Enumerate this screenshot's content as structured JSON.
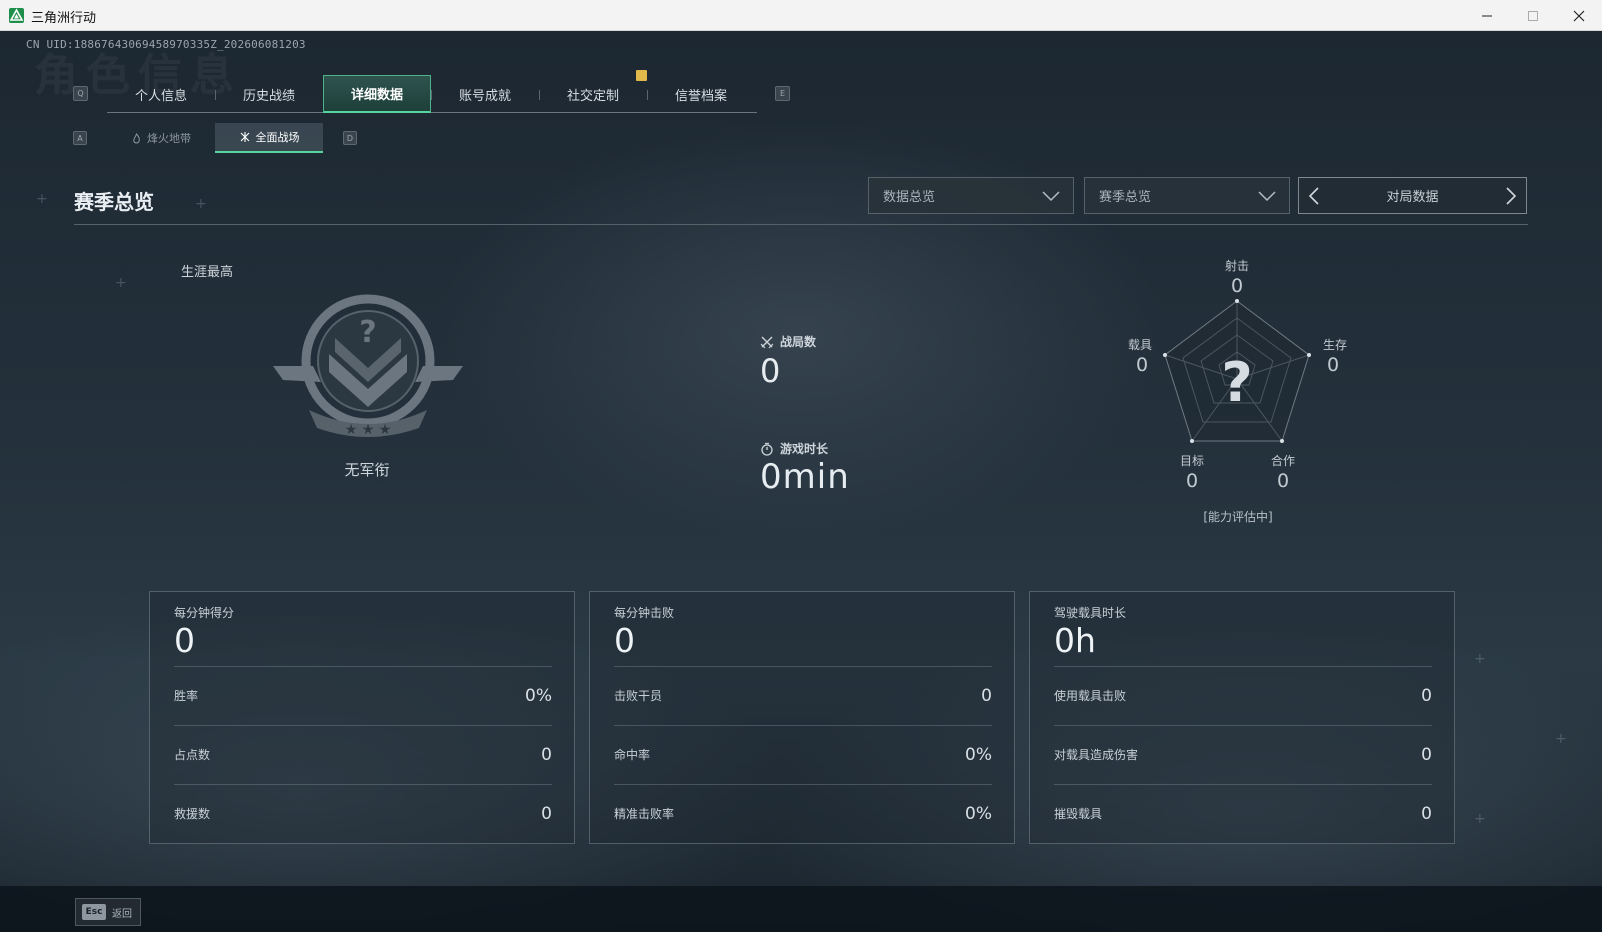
{
  "window": {
    "title": "三角洲行动"
  },
  "uid": "CN UID:18867643069458970335Z_202606081203",
  "background_title": "角色信息",
  "tabs": {
    "key_prev": "Q",
    "key_next": "E",
    "items": [
      {
        "label": "个人信息",
        "active": false
      },
      {
        "label": "历史战绩",
        "active": false
      },
      {
        "label": "详细数据",
        "active": true
      },
      {
        "label": "账号成就",
        "active": false
      },
      {
        "label": "社交定制",
        "active": false
      },
      {
        "label": "信誉档案",
        "active": false
      }
    ]
  },
  "subtabs": {
    "key_prev": "A",
    "key_next": "D",
    "items": [
      {
        "label": "烽火地带",
        "active": false
      },
      {
        "label": "全面战场",
        "active": true
      }
    ]
  },
  "section": {
    "title": "赛季总览",
    "dropdown1": "数据总览",
    "dropdown2": "赛季总览",
    "pager_label": "对局数据"
  },
  "rank": {
    "label": "生涯最高",
    "name": "无军衔"
  },
  "center_stats": {
    "matches_label": "战局数",
    "matches_value": "0",
    "playtime_label": "游戏时长",
    "playtime_value": "0min"
  },
  "radar": {
    "shooting_label": "射击",
    "shooting_value": "0",
    "survival_label": "生存",
    "survival_value": "0",
    "teamwork_label": "合作",
    "teamwork_value": "0",
    "objective_label": "目标",
    "objective_value": "0",
    "vehicle_label": "载具",
    "vehicle_value": "0",
    "status": "[能力评估中]"
  },
  "cards": [
    {
      "title": "每分钟得分",
      "value": "0",
      "rows": [
        {
          "label": "胜率",
          "value": "0%"
        },
        {
          "label": "占点数",
          "value": "0"
        },
        {
          "label": "救援数",
          "value": "0"
        }
      ]
    },
    {
      "title": "每分钟击败",
      "value": "0",
      "rows": [
        {
          "label": "击败干员",
          "value": "0"
        },
        {
          "label": "命中率",
          "value": "0%"
        },
        {
          "label": "精准击败率",
          "value": "0%"
        }
      ]
    },
    {
      "title": "驾驶载具时长",
      "value": "0h",
      "rows": [
        {
          "label": "使用载具击败",
          "value": "0"
        },
        {
          "label": "对载具造成伤害",
          "value": "0"
        },
        {
          "label": "摧毁载具",
          "value": "0"
        }
      ]
    }
  ],
  "bottom": {
    "esc_key": "Esc",
    "esc_label": "返回"
  },
  "colors": {
    "accent": "#55d3a0",
    "alert": "#e0b94a"
  }
}
